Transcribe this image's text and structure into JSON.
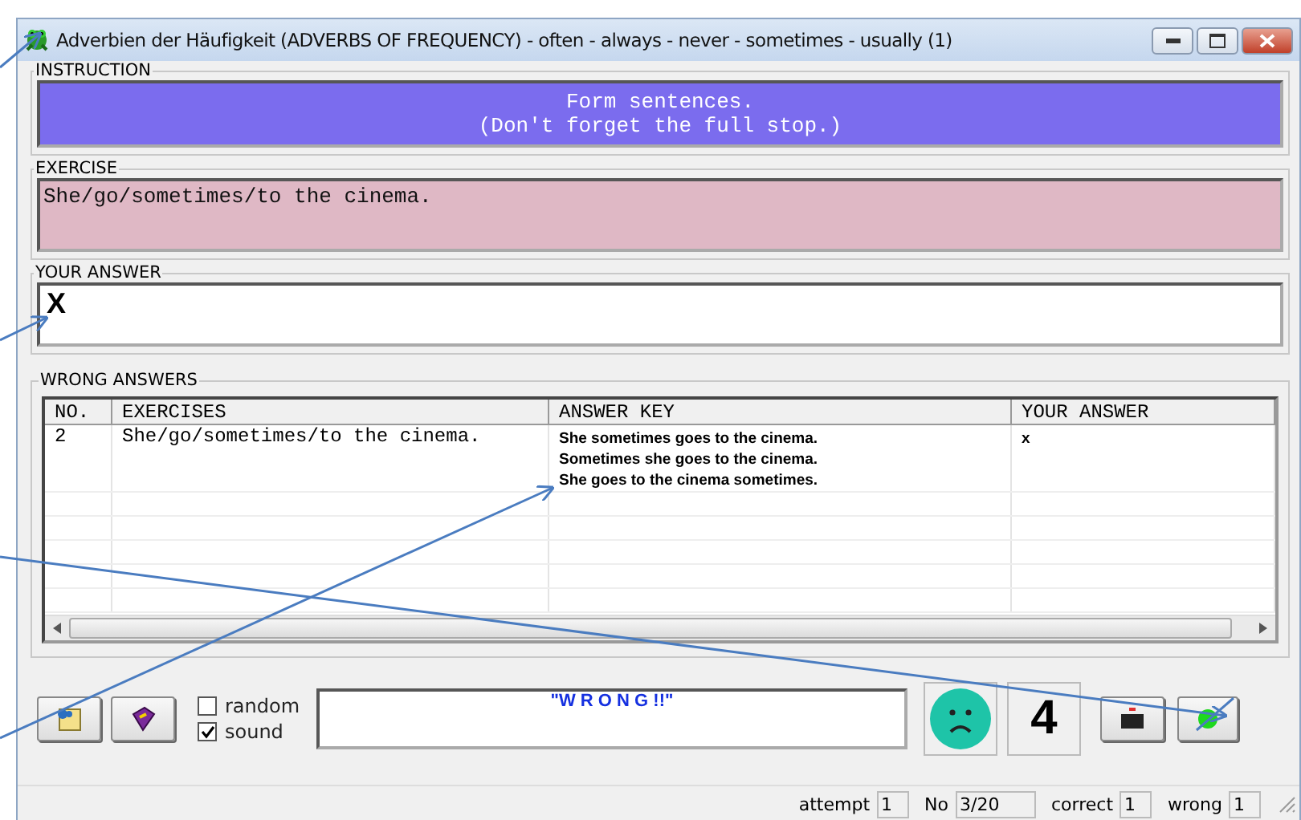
{
  "window": {
    "title": "Adverbien der Häufigkeit (ADVERBS OF FREQUENCY) - often - always - never - sometimes - usually (1)"
  },
  "instruction": {
    "label": "INSTRUCTION",
    "lines": [
      "Form sentences.",
      "(Don't forget the full stop.)"
    ]
  },
  "exercise": {
    "label": "EXERCISE",
    "text": "She/go/sometimes/to the cinema."
  },
  "your_answer": {
    "label": "YOUR ANSWER",
    "value": "X"
  },
  "wrong_answers": {
    "label": "WRONG ANSWERS",
    "columns": [
      "NO.",
      "EXERCISES",
      "ANSWER KEY",
      "YOUR ANSWER"
    ],
    "rows": [
      {
        "no": "2",
        "exercise": "She/go/sometimes/to the cinema.",
        "answer_key": [
          "She sometimes goes to the cinema.",
          "Sometimes she goes to the cinema.",
          "She goes to the cinema sometimes."
        ],
        "your_answer": "x"
      }
    ]
  },
  "options": [
    {
      "label": "random",
      "checked": false
    },
    {
      "label": "sound",
      "checked": true
    }
  ],
  "feedback": "\"W R O N G !!\"",
  "score": "4",
  "status_bar": [
    {
      "label": "attempt",
      "value": "1"
    },
    {
      "label": "No",
      "value": "3/20"
    },
    {
      "label": "correct",
      "value": "1"
    },
    {
      "label": "wrong",
      "value": "1"
    }
  ]
}
